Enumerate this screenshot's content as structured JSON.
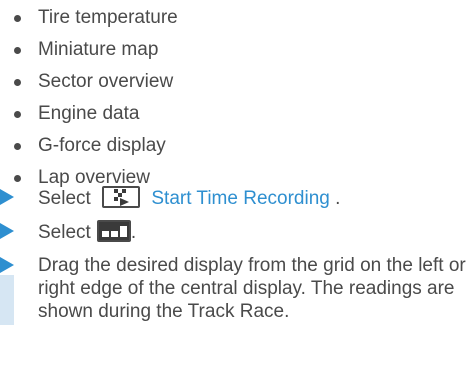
{
  "bullets": [
    "Tire temperature",
    "Miniature map",
    "Sector overview",
    "Engine data",
    "G-force display",
    "Lap overview"
  ],
  "steps": {
    "step1": {
      "prefix": "Select",
      "icon": "checkered-flag-icon",
      "link": "Start Time Recording",
      "suffix": "."
    },
    "step2": {
      "prefix": "Select",
      "icon": "display-layout-icon",
      "suffix": "."
    },
    "step3": {
      "text": "Drag the desired display from the grid on the left or right edge of the central display. The readings are shown during the Track Race."
    }
  },
  "colors": {
    "text": "#4a4a4a",
    "accent": "#2e8fd0",
    "step_bar": "#d6e6f3"
  }
}
